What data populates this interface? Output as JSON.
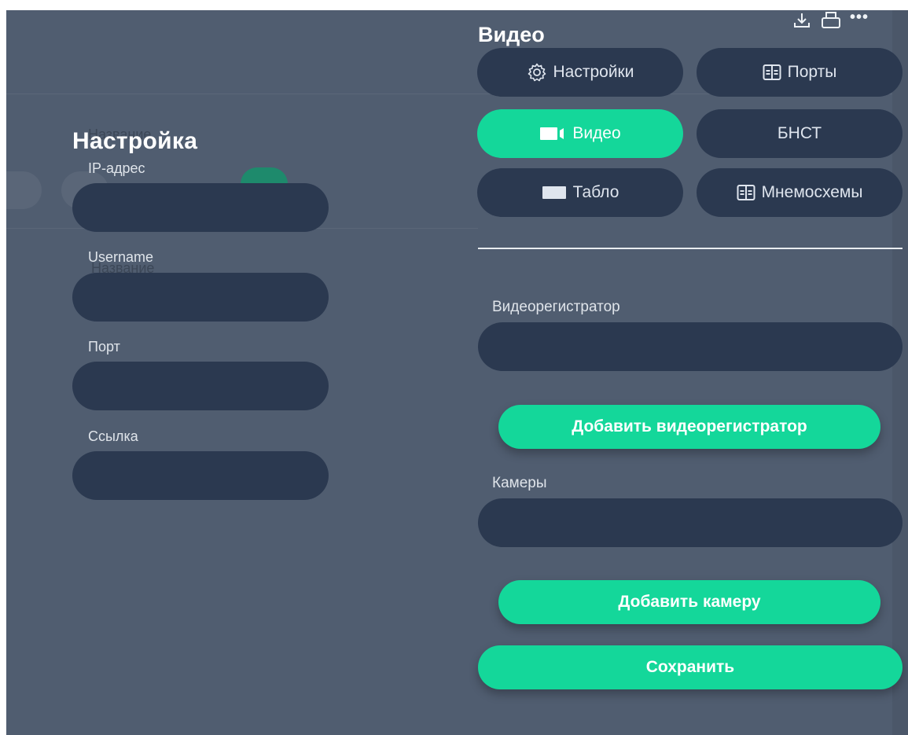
{
  "settings_panel": {
    "title": "Настройка",
    "fields": [
      {
        "label": "IP-адрес",
        "value": ""
      },
      {
        "label": "Username",
        "value": ""
      },
      {
        "label": "Порт",
        "value": ""
      },
      {
        "label": "Ссылка",
        "value": ""
      }
    ],
    "background_overlap_labels": [
      "Название",
      "Название"
    ]
  },
  "video_panel": {
    "title": "Видео",
    "header_icons": [
      "download-icon",
      "print-icon",
      "more-icon"
    ],
    "nav": [
      {
        "label": "Настройки",
        "icon": "gear-icon",
        "active": false
      },
      {
        "label": "Порты",
        "icon": "ports-icon",
        "active": false
      },
      {
        "label": "Видео",
        "icon": "video-camera-icon",
        "active": true
      },
      {
        "label": "БНСТ",
        "icon": "",
        "active": false
      },
      {
        "label": "Табло",
        "icon": "board-icon",
        "active": false
      },
      {
        "label": "Мнемосхемы",
        "icon": "ports-icon",
        "active": false
      }
    ],
    "recorder_label": "Видеорегистратор",
    "recorder_value": "",
    "add_recorder_button": "Добавить видеорегистратор",
    "cameras_label": "Камеры",
    "cameras_value": "",
    "add_camera_button": "Добавить камеру",
    "save_button": "Сохранить"
  },
  "colors": {
    "background": "#505d70",
    "input": "#2b3950",
    "accent": "#14d79a",
    "text": "#ffffff"
  }
}
